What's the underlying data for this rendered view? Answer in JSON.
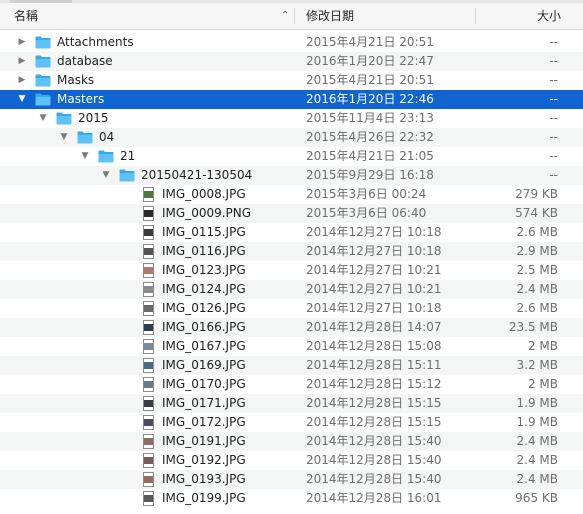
{
  "header": {
    "name_label": "名稱",
    "date_label": "修改日期",
    "size_label": "大小"
  },
  "rows": [
    {
      "name": "Attachments",
      "date": "2015年4月21日 20:51",
      "size": "--",
      "kind": "folder",
      "depth": 0,
      "expanded": false
    },
    {
      "name": "database",
      "date": "2016年1月20日 22:47",
      "size": "--",
      "kind": "folder",
      "depth": 0,
      "expanded": false
    },
    {
      "name": "Masks",
      "date": "2015年4月21日 20:51",
      "size": "--",
      "kind": "folder",
      "depth": 0,
      "expanded": false
    },
    {
      "name": "Masters",
      "date": "2016年1月20日 22:46",
      "size": "--",
      "kind": "folder",
      "depth": 0,
      "expanded": true,
      "selected": true
    },
    {
      "name": "2015",
      "date": "2015年11月4日 23:13",
      "size": "--",
      "kind": "folder",
      "depth": 1,
      "expanded": true
    },
    {
      "name": "04",
      "date": "2015年4月26日 22:32",
      "size": "--",
      "kind": "folder",
      "depth": 2,
      "expanded": true
    },
    {
      "name": "21",
      "date": "2015年4月21日 21:05",
      "size": "--",
      "kind": "folder",
      "depth": 3,
      "expanded": true
    },
    {
      "name": "20150421-130504",
      "date": "2015年9月29日 16:18",
      "size": "--",
      "kind": "folder",
      "depth": 4,
      "expanded": true
    },
    {
      "name": "IMG_0008.JPG",
      "date": "2015年3月6日 00:24",
      "size": "279 KB",
      "kind": "file",
      "thumb": "#4a7a3a"
    },
    {
      "name": "IMG_0009.PNG",
      "date": "2015年3月6日 06:40",
      "size": "574 KB",
      "kind": "file",
      "thumb": "#2b2b2b"
    },
    {
      "name": "IMG_0115.JPG",
      "date": "2014年12月27日 10:18",
      "size": "2.6 MB",
      "kind": "file",
      "thumb": "#3c3c3c"
    },
    {
      "name": "IMG_0116.JPG",
      "date": "2014年12月27日 10:18",
      "size": "2.9 MB",
      "kind": "file",
      "thumb": "#555555"
    },
    {
      "name": "IMG_0123.JPG",
      "date": "2014年12月27日 10:21",
      "size": "2.5 MB",
      "kind": "file",
      "thumb": "#b07a6a"
    },
    {
      "name": "IMG_0124.JPG",
      "date": "2014年12月27日 10:21",
      "size": "2.4 MB",
      "kind": "file",
      "thumb": "#8a8a8a"
    },
    {
      "name": "IMG_0126.JPG",
      "date": "2014年12月27日 10:18",
      "size": "2.6 MB",
      "kind": "file",
      "thumb": "#6a6a6a"
    },
    {
      "name": "IMG_0166.JPG",
      "date": "2014年12月28日 14:07",
      "size": "23.5 MB",
      "kind": "file",
      "thumb": "#2e3a4e"
    },
    {
      "name": "IMG_0167.JPG",
      "date": "2014年12月28日 15:08",
      "size": "2 MB",
      "kind": "file",
      "thumb": "#7a8aa0"
    },
    {
      "name": "IMG_0169.JPG",
      "date": "2014年12月28日 15:11",
      "size": "3.2 MB",
      "kind": "file",
      "thumb": "#4a6a8a"
    },
    {
      "name": "IMG_0170.JPG",
      "date": "2014年12月28日 15:12",
      "size": "2 MB",
      "kind": "file",
      "thumb": "#6a7a8a"
    },
    {
      "name": "IMG_0171.JPG",
      "date": "2014年12月28日 15:15",
      "size": "1.9 MB",
      "kind": "file",
      "thumb": "#3a3a4a"
    },
    {
      "name": "IMG_0172.JPG",
      "date": "2014年12月28日 15:15",
      "size": "1.9 MB",
      "kind": "file",
      "thumb": "#4a4a5a"
    },
    {
      "name": "IMG_0191.JPG",
      "date": "2014年12月28日 15:40",
      "size": "2.4 MB",
      "kind": "file",
      "thumb": "#8a6a6a"
    },
    {
      "name": "IMG_0192.JPG",
      "date": "2014年12月28日 15:40",
      "size": "2.4 MB",
      "kind": "file",
      "thumb": "#7a5a5a"
    },
    {
      "name": "IMG_0193.JPG",
      "date": "2014年12月28日 15:40",
      "size": "2.4 MB",
      "kind": "file",
      "thumb": "#9a6a5a"
    },
    {
      "name": "IMG_0199.JPG",
      "date": "2014年12月28日 16:01",
      "size": "965 KB",
      "kind": "file",
      "thumb": "#5a5a5a"
    }
  ],
  "colors": {
    "selection": "#0f64d2",
    "folder": "#37a9ee",
    "alternate_row": "#f4f5f5"
  }
}
